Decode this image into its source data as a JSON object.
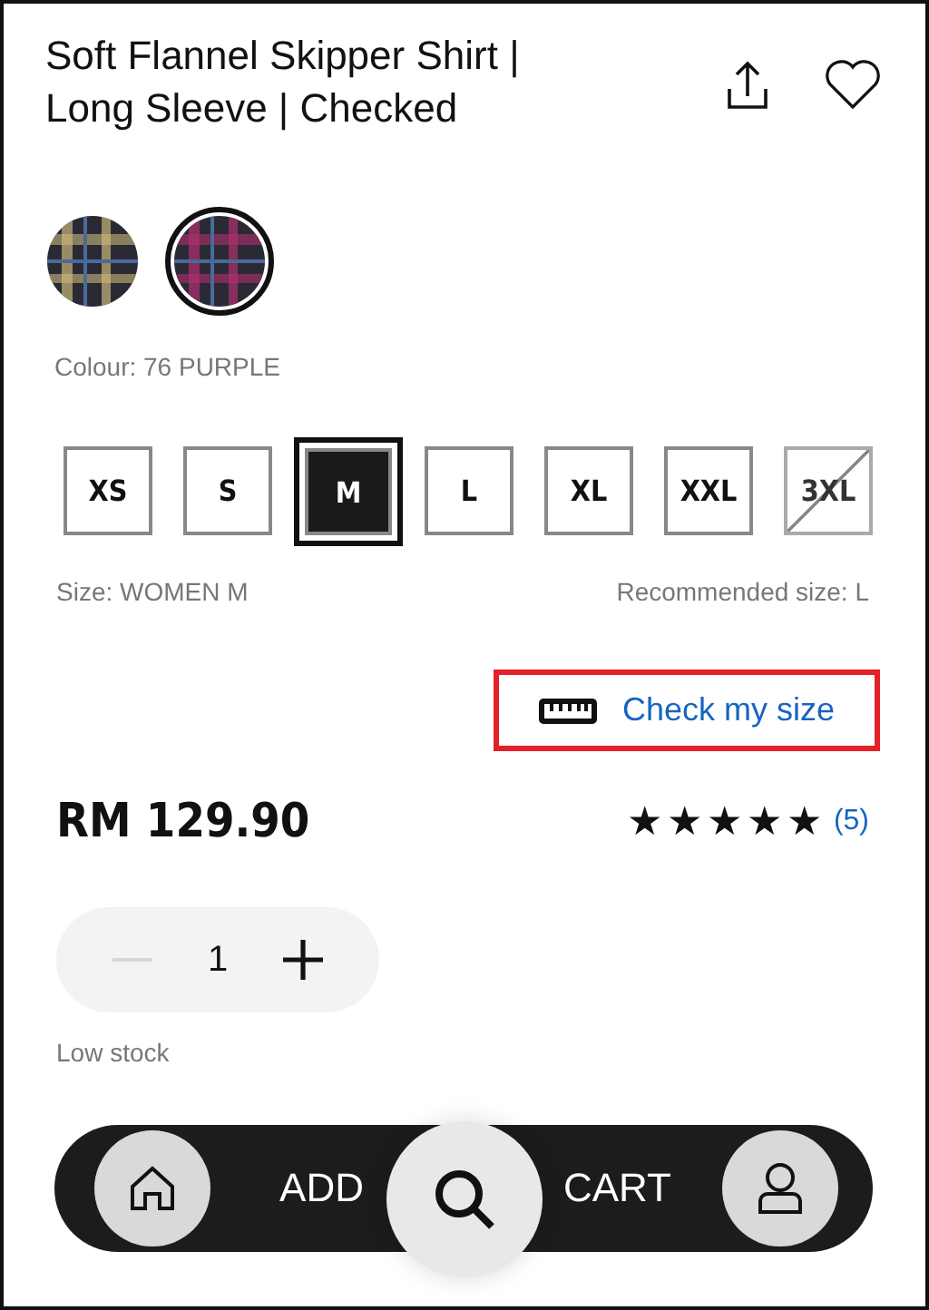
{
  "product": {
    "title": "Soft Flannel Skipper Shirt | Long Sleeve | Checked"
  },
  "swatches": [
    {
      "selected": false
    },
    {
      "selected": true
    }
  ],
  "colour_label": "Colour: 76 PURPLE",
  "sizes": [
    {
      "label": "XS",
      "selected": false,
      "disabled": false
    },
    {
      "label": "S",
      "selected": false,
      "disabled": false
    },
    {
      "label": "M",
      "selected": true,
      "disabled": false
    },
    {
      "label": "L",
      "selected": false,
      "disabled": false
    },
    {
      "label": "XL",
      "selected": false,
      "disabled": false
    },
    {
      "label": "XXL",
      "selected": false,
      "disabled": false
    },
    {
      "label": "3XL",
      "selected": false,
      "disabled": true
    }
  ],
  "size_label": "Size: WOMEN M",
  "recommended_size": "Recommended size: L",
  "check_size_link": {
    "label": "Check my size",
    "highlighted": true
  },
  "price": "RM 129.90",
  "rating": {
    "stars": 5,
    "count": "(5)"
  },
  "quantity": {
    "value": "1",
    "minus_disabled": true
  },
  "stock_note": "Low stock",
  "cart_button": {
    "label_left": "ADD",
    "label_right": "CART"
  }
}
